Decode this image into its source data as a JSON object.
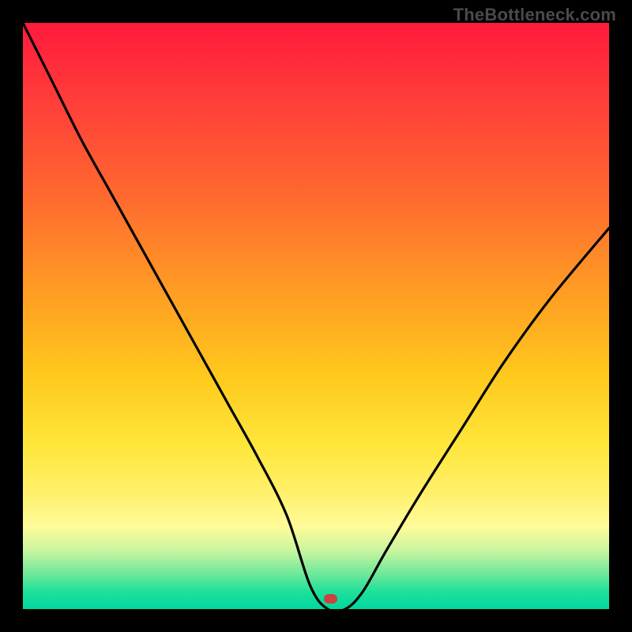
{
  "watermark": "TheBottleneck.com",
  "colors": {
    "frame": "#000000",
    "gradient_top": "#ff1a3c",
    "gradient_mid": "#ffc81c",
    "gradient_bottom": "#00d89e",
    "curve": "#000000",
    "marker": "#c9433f"
  },
  "marker": {
    "x_pct": 52.5,
    "y_pct": 98.2
  },
  "chart_data": {
    "type": "line",
    "title": "",
    "xlabel": "",
    "ylabel": "",
    "xlim": [
      0,
      100
    ],
    "ylim": [
      0,
      100
    ],
    "grid": false,
    "legend": false,
    "series": [
      {
        "name": "bottleneck-curve",
        "x": [
          0,
          5,
          10,
          15,
          20,
          25,
          30,
          35,
          40,
          45,
          49,
          52,
          55,
          58,
          62,
          68,
          75,
          82,
          90,
          100
        ],
        "y": [
          100,
          90,
          80,
          71,
          62,
          53,
          44,
          35,
          26,
          16,
          4,
          0,
          0,
          3,
          10,
          20,
          31,
          42,
          53,
          65
        ]
      }
    ],
    "annotations": [
      {
        "type": "marker",
        "x": 52.5,
        "y": 0,
        "label": ""
      }
    ],
    "notes": "Axes have no visible tick labels; values are normalized 0-100. y measures vertical position of the black curve from bottom (0) to top (100), estimated from pixel positions."
  }
}
